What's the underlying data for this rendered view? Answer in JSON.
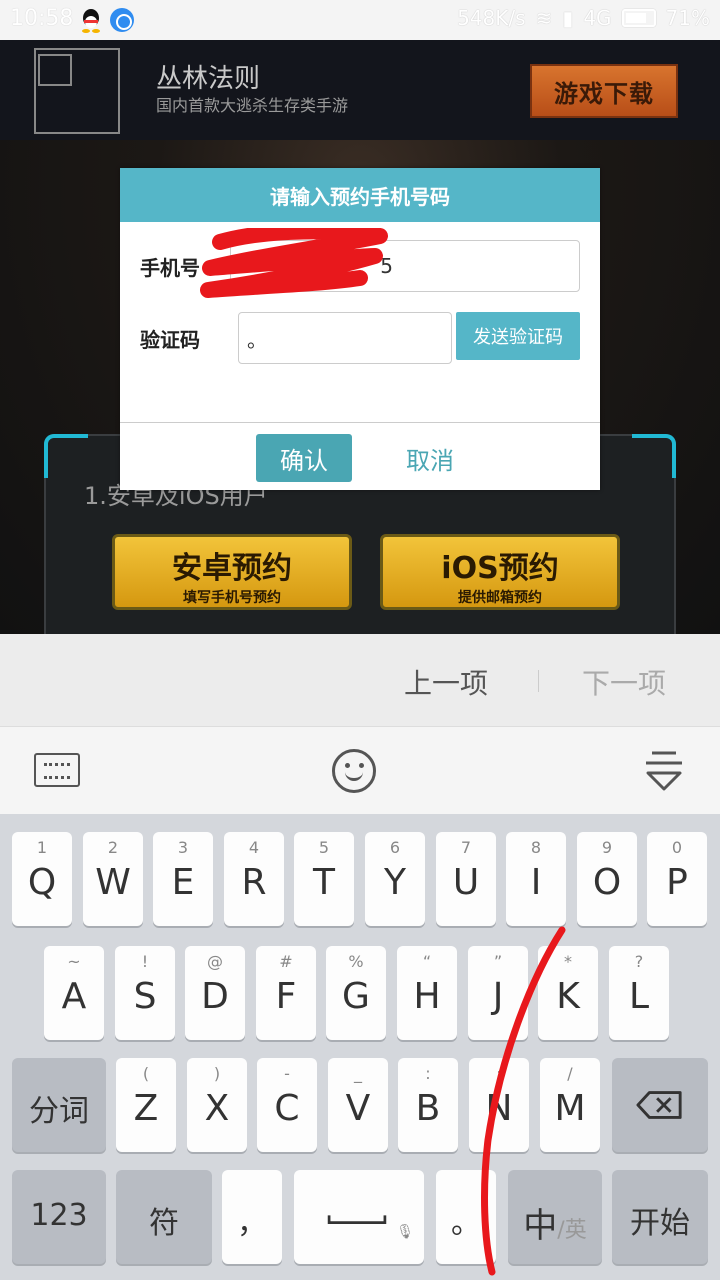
{
  "statusbar": {
    "time": "10:58",
    "speed": "548K/s",
    "network": "4G",
    "battery": "71%"
  },
  "banner": {
    "title": "丛林法则",
    "subtitle": "国内首款大逃杀生存类手游",
    "download_label": "游戏下载"
  },
  "game": {
    "note": "1.安卓及iOS用户",
    "android_btn": {
      "main": "安卓预约",
      "sub": "填写手机号预约"
    },
    "ios_btn": {
      "main": "iOS预约",
      "sub": "提供邮箱预约"
    }
  },
  "dialog": {
    "title": "请输入预约手机号码",
    "phone_label": "手机号",
    "phone_value": "5",
    "code_label": "验证码",
    "code_value": "。",
    "send_code_label": "发送验证码",
    "confirm_label": "确认",
    "cancel_label": "取消"
  },
  "navbar": {
    "prev_label": "上一项",
    "next_label": "下一项"
  },
  "keyboard": {
    "row1": [
      {
        "hint": "1",
        "ch": "Q"
      },
      {
        "hint": "2",
        "ch": "W"
      },
      {
        "hint": "3",
        "ch": "E"
      },
      {
        "hint": "4",
        "ch": "R"
      },
      {
        "hint": "5",
        "ch": "T"
      },
      {
        "hint": "6",
        "ch": "Y"
      },
      {
        "hint": "7",
        "ch": "U"
      },
      {
        "hint": "8",
        "ch": "I"
      },
      {
        "hint": "9",
        "ch": "O"
      },
      {
        "hint": "0",
        "ch": "P"
      }
    ],
    "row2": [
      {
        "hint": "~",
        "ch": "A"
      },
      {
        "hint": "!",
        "ch": "S"
      },
      {
        "hint": "@",
        "ch": "D"
      },
      {
        "hint": "#",
        "ch": "F"
      },
      {
        "hint": "%",
        "ch": "G"
      },
      {
        "hint": "“",
        "ch": "H"
      },
      {
        "hint": "”",
        "ch": "J"
      },
      {
        "hint": "*",
        "ch": "K"
      },
      {
        "hint": "?",
        "ch": "L"
      }
    ],
    "row3": [
      {
        "hint": "(",
        "ch": "Z"
      },
      {
        "hint": ")",
        "ch": "X"
      },
      {
        "hint": "-",
        "ch": "C"
      },
      {
        "hint": "_",
        "ch": "V"
      },
      {
        "hint": ":",
        "ch": "B"
      },
      {
        "hint": ";",
        "ch": "N"
      },
      {
        "hint": "/",
        "ch": "M"
      }
    ],
    "segment_label": "分词",
    "num_label": "123",
    "symbol_label": "符",
    "comma_label": "，",
    "period_label": "。",
    "lang_main": "中",
    "lang_alt": "/英",
    "start_label": "开始"
  }
}
